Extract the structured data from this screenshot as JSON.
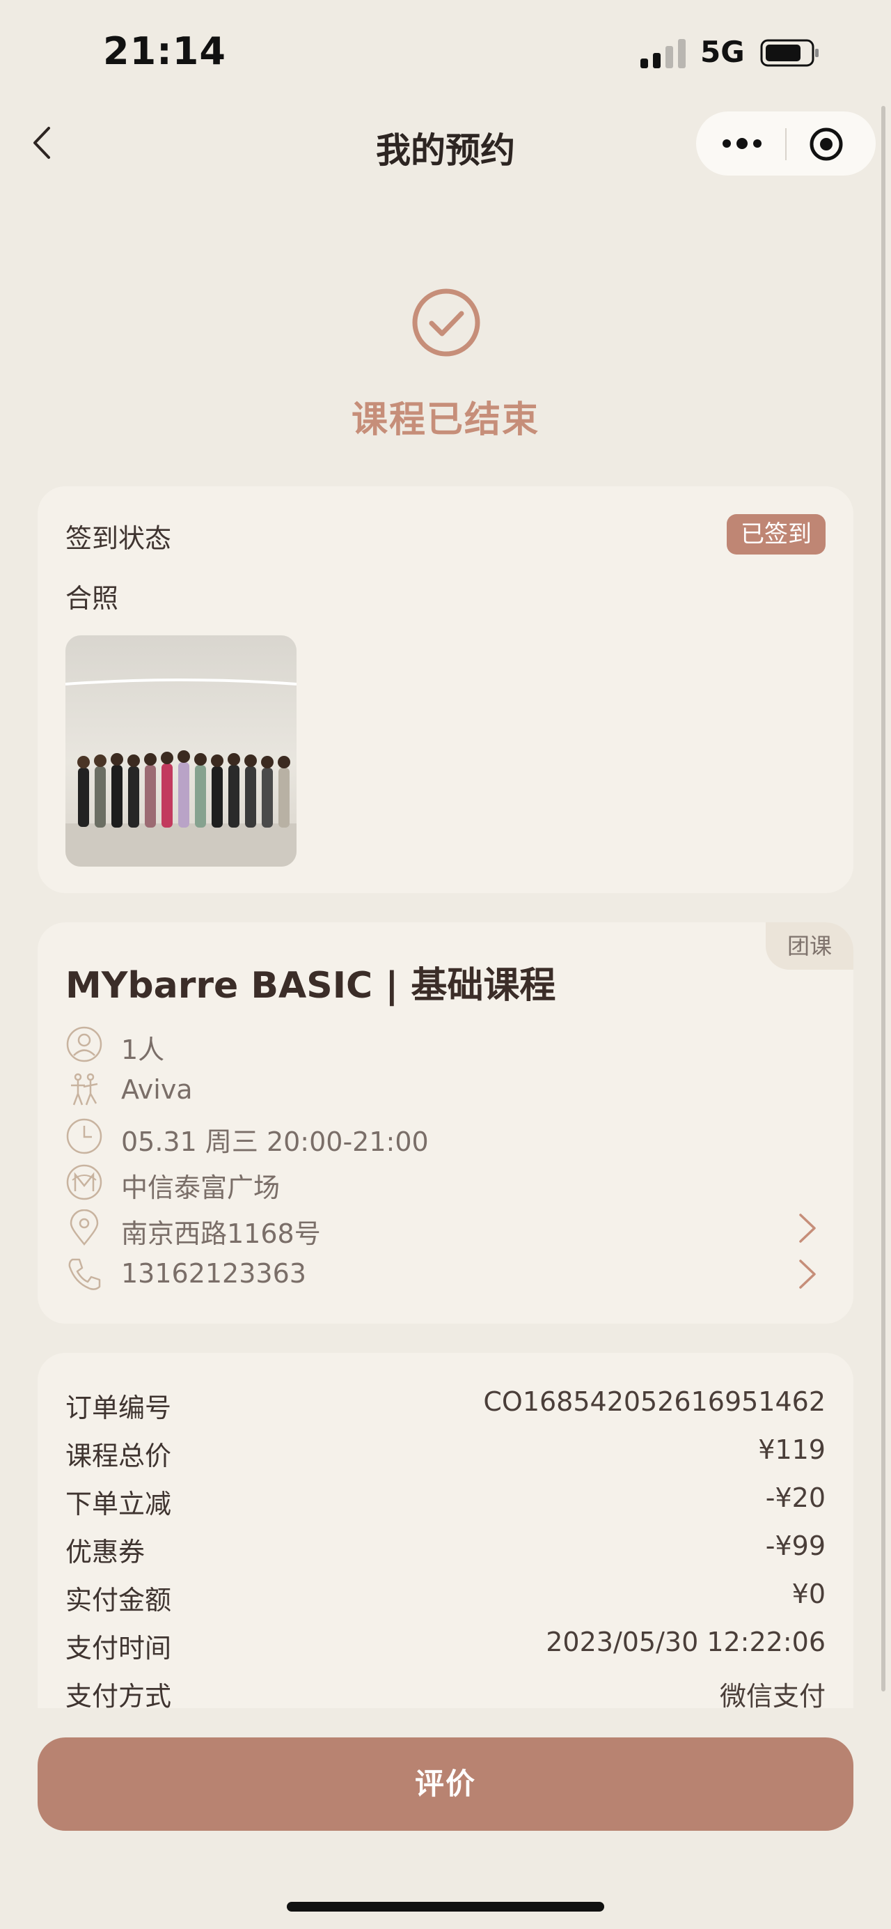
{
  "status_bar": {
    "time": "21:14",
    "network": "5G"
  },
  "nav": {
    "title": "我的预约"
  },
  "status": {
    "title": "课程已结束"
  },
  "checkin": {
    "label": "签到状态",
    "badge": "已签到",
    "photo_label": "合照"
  },
  "course": {
    "title": "MYbarre BASIC | 基础课程",
    "tag": "团课",
    "details": [
      {
        "icon": "person-icon",
        "text": "1人",
        "clickable": false
      },
      {
        "icon": "dancer-icon",
        "text": "Aviva",
        "clickable": false
      },
      {
        "icon": "clock-icon",
        "text": "05.31 周三 20:00-21:00",
        "clickable": false
      },
      {
        "icon": "brand-m-icon",
        "text": "中信泰富广场",
        "clickable": false
      },
      {
        "icon": "location-pin-icon",
        "text": "南京西路1168号",
        "clickable": true
      },
      {
        "icon": "phone-icon",
        "text": "13162123363",
        "clickable": true
      }
    ]
  },
  "order": {
    "rows": [
      {
        "key": "订单编号",
        "value": "CO16854205261695 1462"
      },
      {
        "key": "课程总价",
        "value": "¥119"
      },
      {
        "key": "下单立减",
        "value": "-¥20"
      },
      {
        "key": "优惠券",
        "value": "-¥99"
      },
      {
        "key": "实付金额",
        "value": "¥0"
      },
      {
        "key": "支付时间",
        "value": "2023/05/30 12:22:06"
      },
      {
        "key": "支付方式",
        "value": "微信支付"
      }
    ]
  },
  "cta": {
    "label": "评价"
  },
  "colors": {
    "accent": "#bf8674",
    "background": "#efebe3",
    "card": "#f5f1ea"
  }
}
